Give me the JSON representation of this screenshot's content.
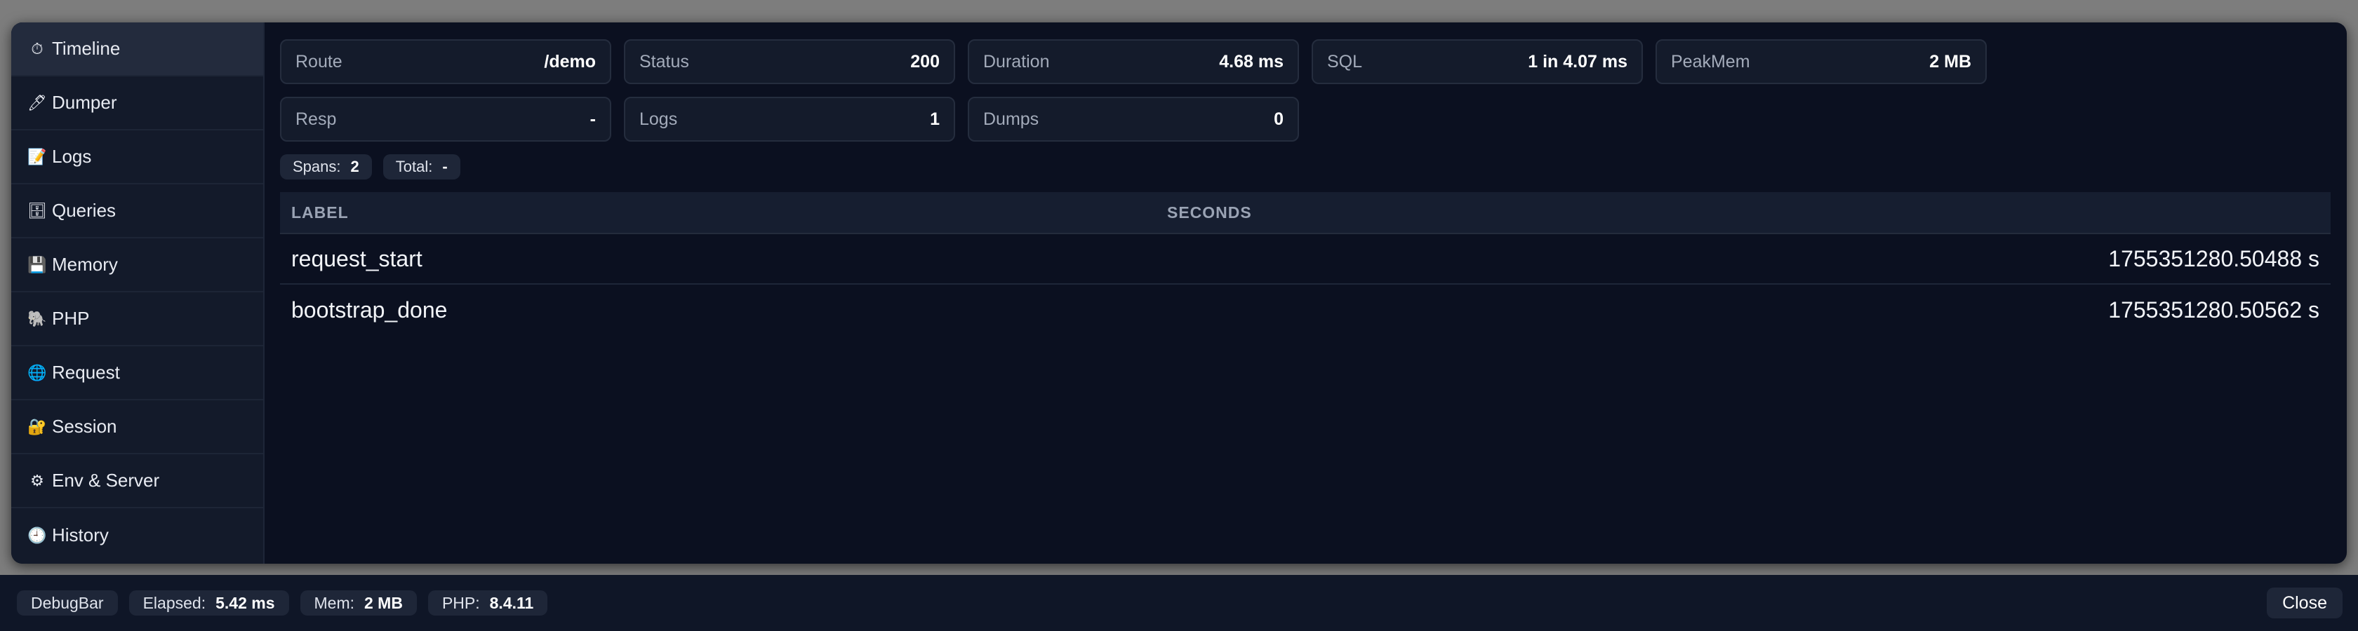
{
  "sidebar": {
    "items": [
      {
        "label": "Timeline",
        "icon": "⏱"
      },
      {
        "label": "Dumper",
        "icon": "🖊"
      },
      {
        "label": "Logs",
        "icon": "📝"
      },
      {
        "label": "Queries",
        "icon": "🗄"
      },
      {
        "label": "Memory",
        "icon": "💾"
      },
      {
        "label": "PHP",
        "icon": "🐘"
      },
      {
        "label": "Request",
        "icon": "🌐"
      },
      {
        "label": "Session",
        "icon": "🔐"
      },
      {
        "label": "Env & Server",
        "icon": "⚙"
      },
      {
        "label": "History",
        "icon": "🕘"
      }
    ],
    "active": "Timeline"
  },
  "metrics": [
    {
      "label": "Route",
      "value": "/demo"
    },
    {
      "label": "Status",
      "value": "200"
    },
    {
      "label": "Duration",
      "value": "4.68 ms"
    },
    {
      "label": "SQL",
      "value": "1 in 4.07 ms"
    },
    {
      "label": "PeakMem",
      "value": "2 MB"
    },
    {
      "label": "Resp",
      "value": "-"
    },
    {
      "label": "Logs",
      "value": "1"
    },
    {
      "label": "Dumps",
      "value": "0"
    }
  ],
  "chips": {
    "spans_label": "Spans:",
    "spans_value": "2",
    "total_label": "Total:",
    "total_value": "-"
  },
  "table": {
    "headers": {
      "label": "LABEL",
      "seconds": "SECONDS"
    },
    "rows": [
      {
        "label": "request_start",
        "seconds": "1755351280.50488 s"
      },
      {
        "label": "bootstrap_done",
        "seconds": "1755351280.50562 s"
      }
    ]
  },
  "bottombar": {
    "brand": "DebugBar",
    "elapsed_label": "Elapsed:",
    "elapsed_value": "5.42 ms",
    "mem_label": "Mem:",
    "mem_value": "2 MB",
    "php_label": "PHP:",
    "php_value": "8.4.11",
    "close_label": "Close"
  }
}
